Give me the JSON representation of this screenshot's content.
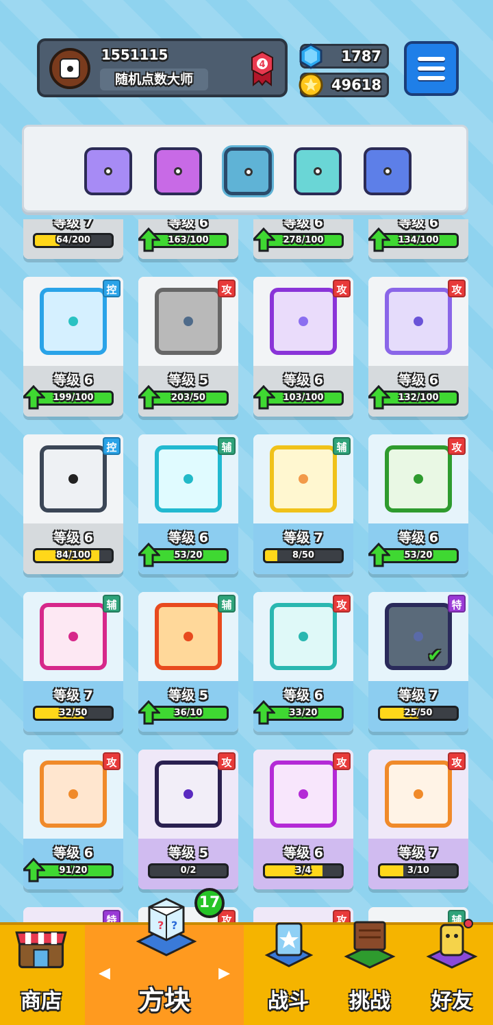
{
  "profile": {
    "player_id": "1551115",
    "title": "随机点数大师",
    "rank": "4"
  },
  "currency": {
    "gems": "1787",
    "gold": "49618"
  },
  "deck": [
    {
      "name": "deck-slot-1",
      "color": "#a78bf5"
    },
    {
      "name": "deck-slot-2",
      "color": "#c86ae6"
    },
    {
      "name": "deck-slot-3",
      "color": "#5fb3d6"
    },
    {
      "name": "deck-slot-4",
      "color": "#6ad6d6"
    },
    {
      "name": "deck-slot-5",
      "color": "#5d7fe8"
    }
  ],
  "partial_row": [
    {
      "level": "等级 7",
      "progress": "64/200",
      "fill": 0.32,
      "upgradable": false
    },
    {
      "level": "等级 6",
      "progress": "163/100",
      "fill": 1.0,
      "upgradable": true
    },
    {
      "level": "等级 6",
      "progress": "278/100",
      "fill": 1.0,
      "upgradable": true
    },
    {
      "level": "等级 6",
      "progress": "134/100",
      "fill": 1.0,
      "upgradable": true
    }
  ],
  "cards": [
    {
      "row": 0,
      "col": 0,
      "rarity": "grey",
      "type": "控",
      "type_color": "#2aa3e8",
      "tile_border": "#2aa3e8",
      "tile_bg": "#d5f0ff",
      "pip": "#2ac2c2",
      "level": "等级 6",
      "progress": "199/100",
      "fill": 1.0,
      "upgradable": true
    },
    {
      "row": 0,
      "col": 1,
      "rarity": "grey",
      "type": "攻",
      "type_color": "#e83a3a",
      "tile_border": "#666",
      "tile_bg": "#b9b9b9",
      "pip": "#4f6b8a",
      "level": "等级 5",
      "progress": "203/50",
      "fill": 1.0,
      "upgradable": true
    },
    {
      "row": 0,
      "col": 2,
      "rarity": "grey",
      "type": "攻",
      "type_color": "#e83a3a",
      "tile_border": "#8a34d8",
      "tile_bg": "#eadcfb",
      "pip": "#8b6ff0",
      "level": "等级 6",
      "progress": "103/100",
      "fill": 1.0,
      "upgradable": true
    },
    {
      "row": 0,
      "col": 3,
      "rarity": "grey",
      "type": "攻",
      "type_color": "#e83a3a",
      "tile_border": "#8a66e8",
      "tile_bg": "#e5dcfb",
      "pip": "#6a54d8",
      "level": "等级 6",
      "progress": "132/100",
      "fill": 1.0,
      "upgradable": true
    },
    {
      "row": 1,
      "col": 0,
      "rarity": "grey",
      "type": "控",
      "type_color": "#2aa3e8",
      "tile_border": "#3b4656",
      "tile_bg": "#eef1f4",
      "pip": "#222",
      "level": "等级 6",
      "progress": "84/100",
      "fill": 0.84,
      "upgradable": false
    },
    {
      "row": 1,
      "col": 1,
      "rarity": "blue",
      "type": "辅",
      "type_color": "#2fa37a",
      "tile_border": "#22b9d0",
      "tile_bg": "#e0fbff",
      "pip": "#22b9c8",
      "level": "等级 6",
      "progress": "53/20",
      "fill": 1.0,
      "upgradable": true
    },
    {
      "row": 1,
      "col": 2,
      "rarity": "blue",
      "type": "辅",
      "type_color": "#2fa37a",
      "tile_border": "#f0c21a",
      "tile_bg": "#fff7d0",
      "pip": "#f29a4a",
      "level": "等级 7",
      "progress": "8/50",
      "fill": 0.16,
      "upgradable": false
    },
    {
      "row": 1,
      "col": 3,
      "rarity": "blue",
      "type": "攻",
      "type_color": "#e83a3a",
      "tile_border": "#2e9b2e",
      "tile_bg": "#e9f8e4",
      "pip": "#2e9b2e",
      "level": "等级 6",
      "progress": "53/20",
      "fill": 1.0,
      "upgradable": true
    },
    {
      "row": 2,
      "col": 0,
      "rarity": "blue",
      "type": "辅",
      "type_color": "#2fa37a",
      "tile_border": "#d6288a",
      "tile_bg": "#fde8f3",
      "pip": "#d6288a",
      "level": "等级 7",
      "progress": "32/50",
      "fill": 0.64,
      "upgradable": false
    },
    {
      "row": 2,
      "col": 1,
      "rarity": "blue",
      "type": "辅",
      "type_color": "#2fa37a",
      "tile_border": "#e84a1e",
      "tile_bg": "#ffd89a",
      "pip": "#e84a1e",
      "level": "等级 5",
      "progress": "36/10",
      "fill": 1.0,
      "upgradable": true
    },
    {
      "row": 2,
      "col": 2,
      "rarity": "blue",
      "type": "攻",
      "type_color": "#e83a3a",
      "tile_border": "#2ab7b0",
      "tile_bg": "#dff9f8",
      "pip": "#2ab7b0",
      "level": "等级 6",
      "progress": "33/20",
      "fill": 1.0,
      "upgradable": true
    },
    {
      "row": 2,
      "col": 3,
      "rarity": "blue",
      "type": "特",
      "type_color": "#9a3ad6",
      "tile_border": "#2a2a5a",
      "tile_bg": "#5a6a7a",
      "pip": "#5a6aa8",
      "level": "等级 7",
      "progress": "25/50",
      "fill": 0.5,
      "upgradable": false,
      "equipped": true
    },
    {
      "row": 3,
      "col": 0,
      "rarity": "blue",
      "type": "攻",
      "type_color": "#e83a3a",
      "tile_border": "#f08a2a",
      "tile_bg": "#ffe6cf",
      "pip": "#f08a2a",
      "level": "等级 6",
      "progress": "91/20",
      "fill": 1.0,
      "upgradable": true
    },
    {
      "row": 3,
      "col": 1,
      "rarity": "purple",
      "type": "攻",
      "type_color": "#e83a3a",
      "tile_border": "#2a2050",
      "tile_bg": "#f2eef8",
      "pip": "#5a2ac0",
      "level": "等级 5",
      "progress": "0/2",
      "fill": 0.0,
      "upgradable": false
    },
    {
      "row": 3,
      "col": 2,
      "rarity": "purple",
      "type": "攻",
      "type_color": "#e83a3a",
      "tile_border": "#b42ad6",
      "tile_bg": "#f8e6fc",
      "pip": "#b42ad6",
      "level": "等级 6",
      "progress": "3/4",
      "fill": 0.75,
      "upgradable": false
    },
    {
      "row": 3,
      "col": 3,
      "rarity": "purple",
      "type": "攻",
      "type_color": "#e83a3a",
      "tile_border": "#f08a2a",
      "tile_bg": "#fff3e6",
      "pip": "#f08a2a",
      "level": "等级 7",
      "progress": "3/10",
      "fill": 0.3,
      "upgradable": false
    }
  ],
  "peek_row": [
    {
      "type": "特",
      "type_color": "#9a3ad6"
    },
    {
      "type": "攻",
      "type_color": "#e83a3a"
    },
    {
      "type": "攻",
      "type_color": "#e83a3a"
    },
    {
      "type": "辅",
      "type_color": "#2fa37a"
    }
  ],
  "nav": {
    "shop": "商店",
    "blocks": "方块",
    "battle": "战斗",
    "challenge": "挑战",
    "friends": "好友",
    "blocks_badge": "17"
  }
}
